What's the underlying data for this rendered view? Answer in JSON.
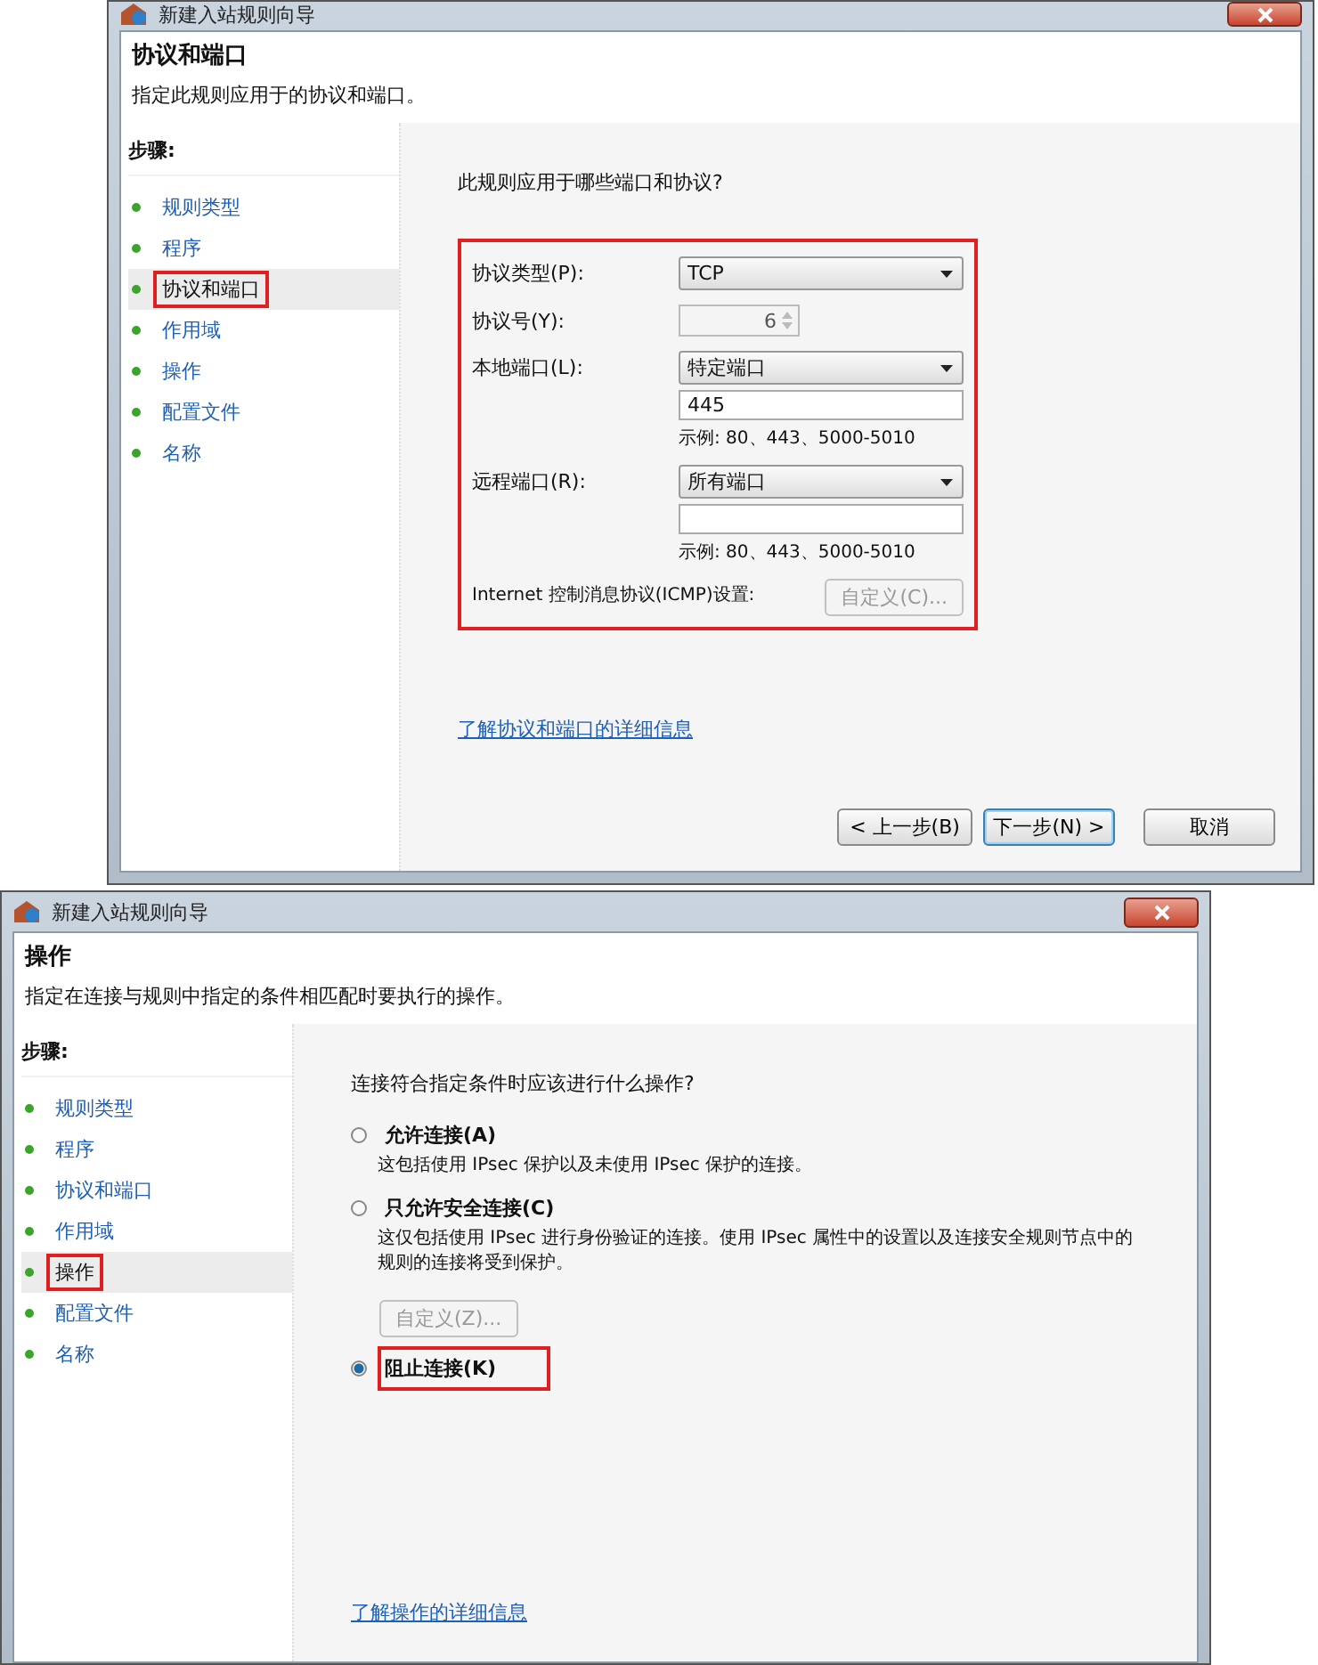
{
  "dialogs": [
    {
      "title": "新建入站规则向导",
      "heading": "协议和端口",
      "description": "指定此规则应用于的协议和端口。",
      "steps_label": "步骤:",
      "steps": [
        {
          "label": "规则类型",
          "selected": false,
          "highlighted": false
        },
        {
          "label": "程序",
          "selected": false,
          "highlighted": false
        },
        {
          "label": "协议和端口",
          "selected": true,
          "highlighted": true
        },
        {
          "label": "作用域",
          "selected": false,
          "highlighted": false
        },
        {
          "label": "操作",
          "selected": false,
          "highlighted": false
        },
        {
          "label": "配置文件",
          "selected": false,
          "highlighted": false
        },
        {
          "label": "名称",
          "selected": false,
          "highlighted": false
        }
      ],
      "content": {
        "kind": "ports",
        "question": "此规则应用于哪些端口和协议?",
        "highlighted": true,
        "fields": [
          {
            "kind": "select",
            "label": "协议类型(P):",
            "value": "TCP"
          },
          {
            "kind": "spin",
            "label": "协议号(Y):",
            "value": "6",
            "disabled": true
          },
          {
            "kind": "select",
            "label": "本地端口(L):",
            "value": "特定端口",
            "input": "445",
            "hint": "示例: 80、443、5000-5010"
          },
          {
            "kind": "select",
            "label": "远程端口(R):",
            "value": "所有端口",
            "input_shown": true,
            "hint": "示例: 80、443、5000-5010"
          },
          {
            "kind": "button",
            "label": "Internet 控制消息协议(ICMP)设置:",
            "button": "自定义(C)...",
            "disabled": true
          }
        ]
      },
      "link": "了解协议和端口的详细信息",
      "buttons": [
        {
          "label": "< 上一步(B)",
          "default": false
        },
        {
          "label": "下一步(N) >",
          "default": true
        },
        {
          "label": "取消",
          "default": false
        }
      ]
    },
    {
      "title": "新建入站规则向导",
      "heading": "操作",
      "description": "指定在连接与规则中指定的条件相匹配时要执行的操作。",
      "steps_label": "步骤:",
      "steps": [
        {
          "label": "规则类型",
          "selected": false,
          "highlighted": false
        },
        {
          "label": "程序",
          "selected": false,
          "highlighted": false
        },
        {
          "label": "协议和端口",
          "selected": false,
          "highlighted": false
        },
        {
          "label": "作用域",
          "selected": false,
          "highlighted": false
        },
        {
          "label": "操作",
          "selected": true,
          "highlighted": true
        },
        {
          "label": "配置文件",
          "selected": false,
          "highlighted": false
        },
        {
          "label": "名称",
          "selected": false,
          "highlighted": false
        }
      ],
      "content": {
        "kind": "options",
        "question": "连接符合指定条件时应该进行什么操作?",
        "options": [
          {
            "label": "允许连接(A)",
            "description": "这包括使用 IPsec 保护以及未使用 IPsec 保护的连接。",
            "selected": false,
            "highlighted": false
          },
          {
            "label": "只允许安全连接(C)",
            "description": "这仅包括使用 IPsec 进行身份验证的连接。使用 IPsec 属性中的设置以及连接安全规则节点中的规则的连接将受到保护。",
            "selected": false,
            "highlighted": false,
            "button": "自定义(Z)...",
            "button_disabled": true
          },
          {
            "label": "阻止连接(K)",
            "selected": true,
            "highlighted": true
          }
        ]
      },
      "link": "了解操作的详细信息"
    }
  ]
}
